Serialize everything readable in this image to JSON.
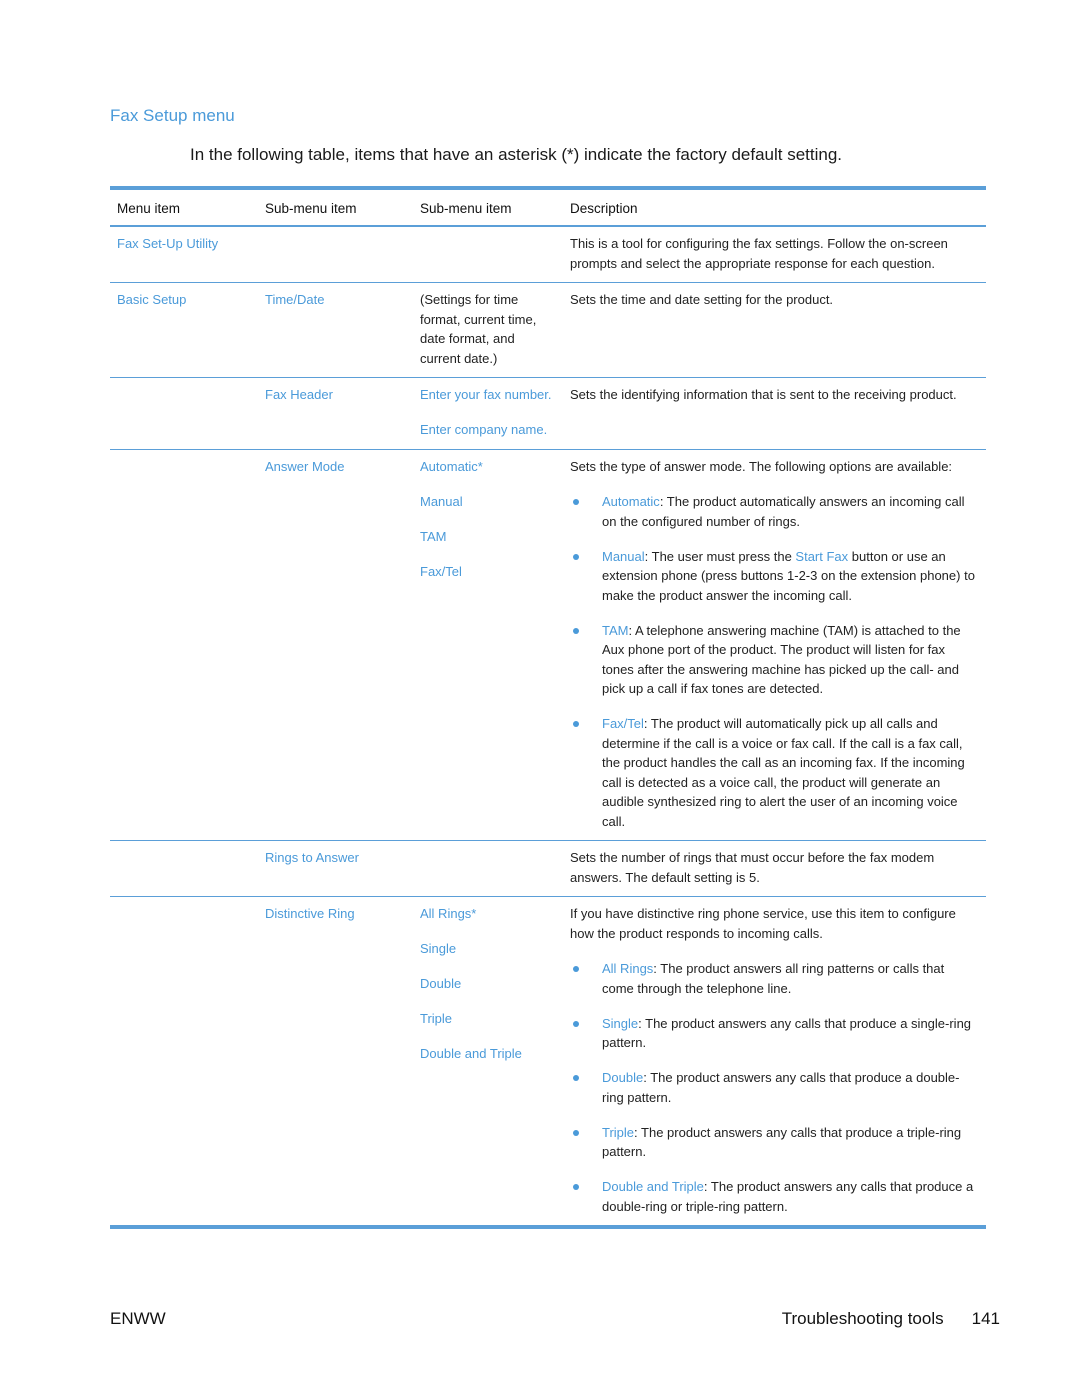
{
  "section_title": "Fax Setup menu",
  "intro": "In the following table, items that have an asterisk (*) indicate the factory default setting.",
  "table": {
    "headers": [
      "Menu item",
      "Sub-menu item",
      "Sub-menu item",
      "Description"
    ],
    "rows": {
      "fax_setup_utility": {
        "menu_item": "Fax Set-Up Utility",
        "description": "This is a tool for configuring the fax settings. Follow the on-screen prompts and select the appropriate response for each question."
      },
      "time_date": {
        "menu_item": "Basic Setup",
        "sub_item": "Time/Date",
        "sub_sub_item": "(Settings for time format, current time, date format, and current date.)",
        "description": "Sets the time and date setting for the product."
      },
      "fax_header": {
        "sub_item": "Fax Header",
        "options": [
          "Enter your fax number.",
          "Enter company name."
        ],
        "description": "Sets the identifying information that is sent to the receiving product."
      },
      "answer_mode": {
        "sub_item": "Answer Mode",
        "options": [
          "Automatic*",
          "Manual",
          "TAM",
          "Fax/Tel"
        ],
        "description": "Sets the type of answer mode. The following options are available:",
        "bullets": [
          {
            "term": "Automatic",
            "text": ": The product automatically answers an incoming call on the configured number of rings."
          },
          {
            "term": "Manual",
            "text_before": ": The user must press the ",
            "link": "Start Fax",
            "text": " button or use an extension phone (press buttons 1-2-3 on the extension phone) to make the product answer the incoming call."
          },
          {
            "term": "TAM",
            "text": ": A telephone answering machine (TAM) is attached to the Aux phone port of the product. The product will listen for fax tones after the answering machine has picked up the call- and pick up a call if fax tones are detected."
          },
          {
            "term": "Fax/Tel",
            "text": ": The product will automatically pick up all calls and determine if the call is a voice or fax call. If the call is a fax call, the product handles the call as an incoming fax. If the incoming call is detected as a voice call, the product will generate an audible synthesized ring to alert the user of an incoming voice call."
          }
        ]
      },
      "rings_to_answer": {
        "sub_item": "Rings to Answer",
        "description": "Sets the number of rings that must occur before the fax modem answers. The default setting is 5."
      },
      "distinctive_ring": {
        "sub_item": "Distinctive Ring",
        "options": [
          "All Rings*",
          "Single",
          "Double",
          "Triple",
          "Double and Triple"
        ],
        "description": "If you have distinctive ring phone service, use this item to configure how the product responds to incoming calls.",
        "bullets": [
          {
            "term": "All Rings",
            "text": ": The product answers all ring patterns or calls that come through the telephone line."
          },
          {
            "term": "Single",
            "text": ": The product answers any calls that produce a single-ring pattern."
          },
          {
            "term": "Double",
            "text": ": The product answers any calls that produce a double-ring pattern."
          },
          {
            "term": "Triple",
            "text": ": The product answers any calls that produce a triple-ring pattern."
          },
          {
            "term": "Double and Triple",
            "text": ": The product answers any calls that produce a double-ring or triple-ring pattern."
          }
        ]
      }
    }
  },
  "footer": {
    "left": "ENWW",
    "section": "Troubleshooting tools",
    "page_number": "141"
  },
  "colors": {
    "accent": "#4a9ad9",
    "rule": "#5b9fd8"
  }
}
